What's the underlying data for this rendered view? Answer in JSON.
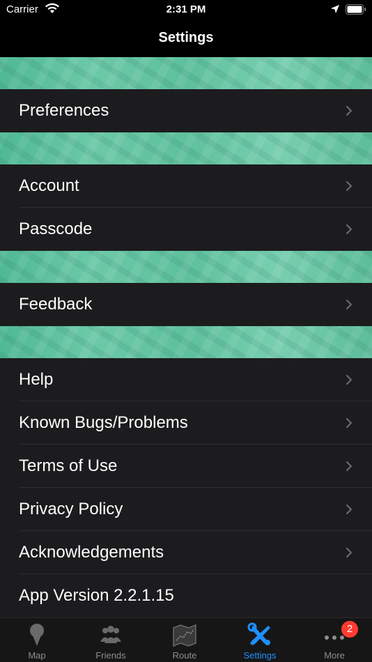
{
  "status": {
    "carrier": "Carrier",
    "time": "2:31 PM"
  },
  "nav": {
    "title": "Settings"
  },
  "sections": [
    {
      "items": [
        "Preferences"
      ]
    },
    {
      "items": [
        "Account",
        "Passcode"
      ]
    },
    {
      "items": [
        "Feedback"
      ]
    },
    {
      "items": [
        "Help",
        "Known Bugs/Problems",
        "Terms of Use",
        "Privacy Policy",
        "Acknowledgements",
        "App Version 2.2.1.15"
      ]
    }
  ],
  "tabs": [
    {
      "label": "Map",
      "icon": "map-pin-icon"
    },
    {
      "label": "Friends",
      "icon": "friends-icon"
    },
    {
      "label": "Route",
      "icon": "route-icon"
    },
    {
      "label": "Settings",
      "icon": "tools-icon",
      "active": true
    },
    {
      "label": "More",
      "icon": "more-icon"
    }
  ],
  "badge": "2",
  "colors": {
    "accent": "#1e90ff",
    "cell": "#1c1c1e",
    "badge": "#ff3b30",
    "banner": "#5ec09d"
  }
}
